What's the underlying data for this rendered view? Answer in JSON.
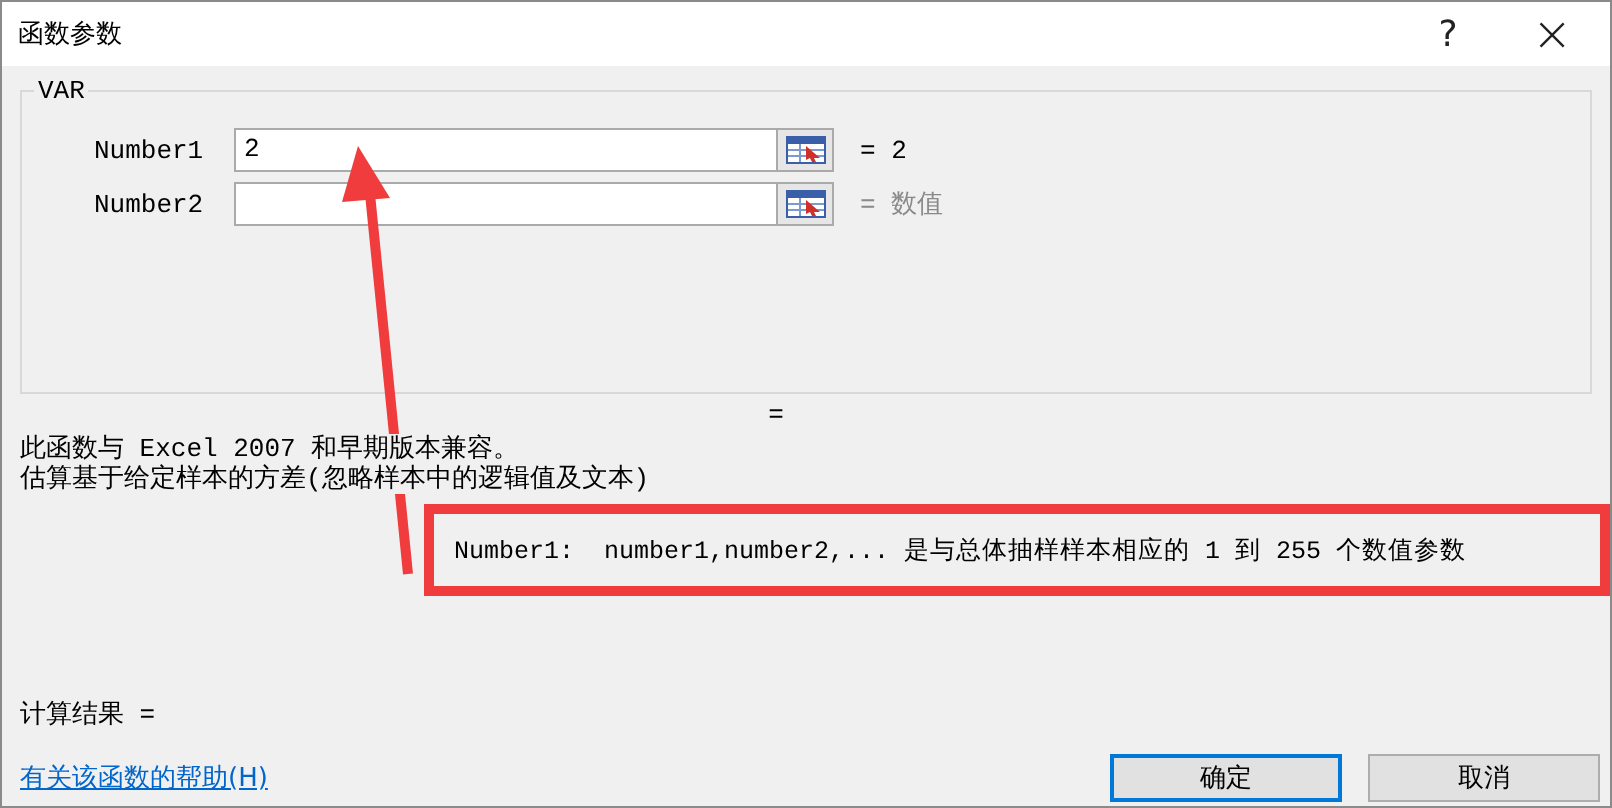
{
  "window": {
    "title": "函数参数",
    "help": "?",
    "close": "×"
  },
  "function_name": "VAR",
  "arguments": [
    {
      "label": "Number1",
      "value": "2",
      "result": "= 2",
      "result_muted": false
    },
    {
      "label": "Number2",
      "result": "= 数值",
      "result_muted": true
    }
  ],
  "formula_result": "=",
  "description_lines": [
    "此函数与 Excel 2007 和早期版本兼容。",
    "估算基于给定样本的方差(忽略样本中的逻辑值及文本)"
  ],
  "argument_help": "Number1:  number1,number2,... 是与总体抽样样本相应的 1 到 255 个数值参数",
  "calculation_result": "计算结果 =",
  "help_link": "有关该函数的帮助(H)",
  "buttons": [
    {
      "label": "确定",
      "selected": true
    },
    {
      "label": "取消",
      "selected": false
    }
  ]
}
